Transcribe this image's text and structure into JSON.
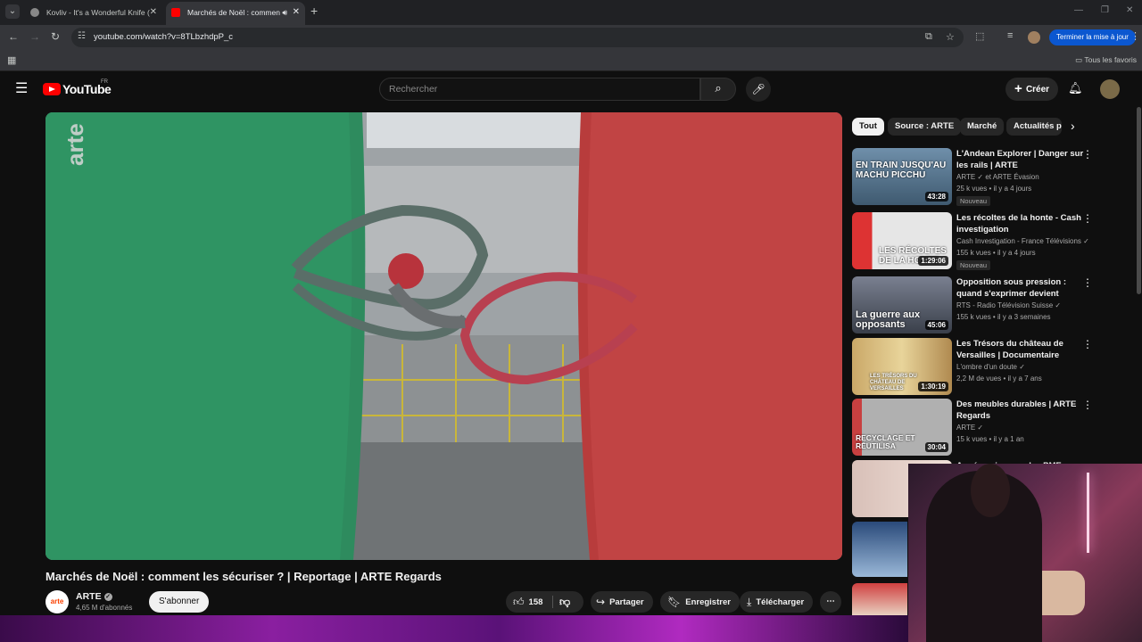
{
  "browser": {
    "tabs": [
      {
        "title": "Kovliv - It's a Wonderful Knife (",
        "active": false
      },
      {
        "title": "Marchés de Noël : commen",
        "active": true
      }
    ],
    "url": "youtube.com/watch?v=8TLbzhdpP_c",
    "update_button": "Terminer la mise à jour",
    "all_bookmarks": "Tous les favoris"
  },
  "youtube": {
    "logo_text": "YouTube",
    "region": "FR",
    "search_placeholder": "Rechercher",
    "create_label": "Créer"
  },
  "video": {
    "watermark": "arte",
    "title": "Marchés de Noël : comment les sécuriser ? | Reportage | ARTE Regards",
    "channel": "ARTE",
    "channel_avatar": "arte",
    "subscribers": "4,65 M d'abonnés",
    "subscribe_label": "S'abonner",
    "likes": "158",
    "share_label": "Partager",
    "save_label": "Enregistrer",
    "download_label": "Télécharger"
  },
  "chips": [
    "Tout",
    "Source : ARTE",
    "Marché",
    "Actualités p"
  ],
  "recommendations": [
    {
      "title": "L'Andean Explorer | Danger sur les rails | ARTE",
      "channel": "ARTE ✓ et ARTE Évasion",
      "meta": "25 k vues • il y a 4 jours",
      "badge": "Nouveau",
      "duration": "43:28",
      "thumb_text": "EN TRAIN JUSQU'AU MACHU PICCHU",
      "thumb_color": "#5a7a9a"
    },
    {
      "title": "Les récoltes de la honte - Cash investigation",
      "channel": "Cash Investigation - France Télévisions ✓",
      "meta": "155 k vues • il y a 4 jours",
      "badge": "Nouveau",
      "duration": "1:29:06",
      "thumb_text": "LES RÉCOLTES DE LA HONTE",
      "thumb_color": "#c8c8c8"
    },
    {
      "title": "Opposition sous pression : quand s'exprimer devient risqu...",
      "channel": "RTS - Radio Télévision Suisse ✓",
      "meta": "155 k vues • il y a 3 semaines",
      "badge": "",
      "duration": "45:06",
      "thumb_text": "La guerre aux opposants",
      "thumb_color": "#6a7080"
    },
    {
      "title": "Les Trésors du château de Versailles | Documentaire",
      "channel": "L'ombre d'un doute ✓",
      "meta": "2,2 M de vues • il y a 7 ans",
      "badge": "",
      "duration": "1:30:19",
      "thumb_text": "LES TRÉSORS DU CHÂTEAU DE VERSAILLES",
      "thumb_color": "#b8a070"
    },
    {
      "title": "Des meubles durables | ARTE Regards",
      "channel": "ARTE ✓",
      "meta": "15 k vues • il y a 1 an",
      "badge": "",
      "duration": "30:04",
      "thumb_text": "RECYCLAGE ET RÉUTILISA",
      "thumb_color": "#8a8a8a"
    },
    {
      "title": "Année noire pour les PME ...",
      "channel": "",
      "meta": "",
      "badge": "",
      "duration": "",
      "thumb_text": "",
      "thumb_color": "#c05050"
    }
  ]
}
